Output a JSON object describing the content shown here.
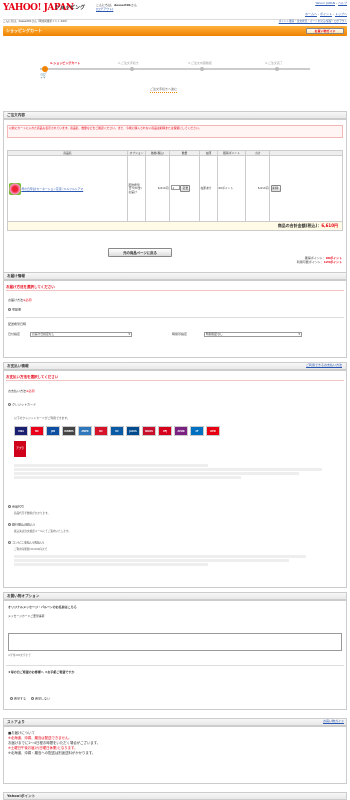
{
  "header": {
    "logo": "YAHOO! JAPAN",
    "shopping": "ショッピング",
    "greeting": "こんにちは、",
    "user": "dessert01",
    "san": "さん",
    "logout": "[ログアウト]",
    "top_links": [
      "Yahoo! JAPAN",
      "ヘルプ"
    ],
    "right_links": [
      "ホームへ",
      "ポイント",
      "トップへ"
    ]
  },
  "userbar": {
    "text": "こんにちは、dessert01さん（利用可能ポイント:100）",
    "links": "ポイント獲得・注文状況・カートを見る/保留・ログアウト"
  },
  "cart_bar": {
    "title": "ショッピングカート",
    "button": "お買い物ガイド"
  },
  "steps": [
    "1.ショッピングカート",
    "2.ご注文手続き",
    "3.ご注文内容確認",
    "4.ご注文完了"
  ],
  "step_note": "ご注文手続きへ進む",
  "order": {
    "heading": "ご注文内容",
    "notice": "以前にカートに入れた商品も表示されています。商品名、数量などをご確認ください。また、今後に購入されない商品は削除または保留にしてください。",
    "columns": [
      "商品名",
      "オプション",
      "価格(税込)",
      "数量",
      "",
      "在庫",
      "獲得ポイント",
      "小計",
      ""
    ],
    "item": {
      "name": "母の日早割!カーネーション花束 (ミルフルシアマ",
      "option": "配送希望日:5/8(金)お届け",
      "price": "6,610円",
      "qty": "1",
      "update": "変更",
      "stock": "在庫あり",
      "points": "60ポイント",
      "subtotal": "6,610円",
      "delete": "削除"
    },
    "total_label": "商品の合計金額(税込)：",
    "total": "6,610円",
    "back_button": "元の商品ページに戻る",
    "points_label": "獲得ポイント：",
    "points_value": "60ポイント",
    "avail_label": "利用可能ポイント：",
    "avail_value": "123ポイント"
  },
  "delivery": {
    "heading": "お届け情報",
    "sub": "お届け方法を選択してください",
    "method_label": "お届け方法",
    "required": "※必須",
    "method": "宅配便",
    "date_label": "配送希望日時",
    "day_label": "日付指定",
    "day_value": "お届け日指定なし",
    "time_label": "時間帯指定",
    "time_value": "時間指定なし"
  },
  "payment": {
    "heading": "お支払い情報",
    "sub": "お支払い方法を選択してください",
    "method_label": "お支払い方法",
    "required": "※必須",
    "link": "ご利用できるお支払い方法",
    "credit": "クレジットカード",
    "credit_note": "以下のクレジットカードがご利用できます。",
    "cards": [
      {
        "label": "VISA",
        "color": "#1a1f71"
      },
      {
        "label": "MC",
        "color": "#eb001b"
      },
      {
        "label": "JCB",
        "color": "#0b4ea2"
      },
      {
        "label": "DINERS",
        "color": "#444"
      },
      {
        "label": "AMEX",
        "color": "#2e77bb"
      },
      {
        "label": "DC",
        "color": "#d7132a"
      },
      {
        "label": "UC",
        "color": "#0a5ba6"
      },
      {
        "label": "JACCS",
        "color": "#004b8d"
      },
      {
        "label": "NICOS",
        "color": "#c8102e"
      },
      {
        "label": "UFJ",
        "color": "#d6001c"
      },
      {
        "label": "AEON",
        "color": "#7a2182"
      },
      {
        "label": "CF",
        "color": "#0070c0"
      },
      {
        "label": "KPN",
        "color": "#e60012"
      }
    ],
    "bank": "商品代引",
    "bank_note": "商品代引手数料がかかります。",
    "furikomi": "銀行振込(前払い)",
    "furikomi_note": "振込先は注文確認メールにてご案内いたします。",
    "conv": "コンビニ支払い(先払い)",
    "conv_note": "ご利用可能額 50,000円まで"
  },
  "options": {
    "heading": "お買い物オプション",
    "sub": "オリジナルメッセージ・バルーンのお名前はこちら",
    "msg_label": "メッセージカードご要望事項",
    "msg_placeholder": "",
    "limit": "※半角200文字まで",
    "gift_label": "★母の日ご希望のお客様へ ★お手紙ご希望ですか",
    "gift_yes": "希望する",
    "gift_no": "希望しない"
  },
  "store": {
    "heading": "ストアより",
    "link": "お買い物ガイド",
    "lines": [
      "■お届けについて",
      "※北海道、沖縄、離島は配送できません。",
      "お届けまでに2～4日程お時間をいただく場合がございます。",
      "※土曜日午後お届け(日曜日休業)となります。",
      "※北海道、沖縄・離島への配送は別途送料がかかります。"
    ]
  },
  "footer": {
    "heading": "Yahoo!ポイント"
  }
}
